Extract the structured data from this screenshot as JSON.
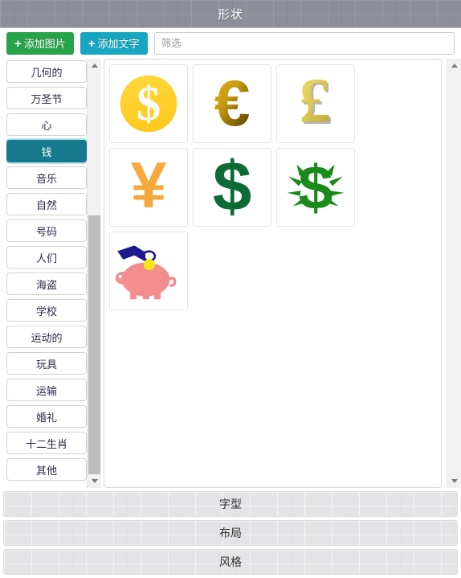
{
  "window": {
    "title": "形状"
  },
  "toolbar": {
    "add_image_label": "添加图片",
    "add_text_label": "添加文字",
    "filter_placeholder": "筛选",
    "filter_value": ""
  },
  "sidebar": {
    "selected": "钱",
    "items": [
      {
        "label": "几何的",
        "selected": false
      },
      {
        "label": "万圣节",
        "selected": false
      },
      {
        "label": "心",
        "selected": false
      },
      {
        "label": "钱",
        "selected": true
      },
      {
        "label": "音乐",
        "selected": false
      },
      {
        "label": "自然",
        "selected": false
      },
      {
        "label": "号码",
        "selected": false
      },
      {
        "label": "人们",
        "selected": false
      },
      {
        "label": "海盗",
        "selected": false
      },
      {
        "label": "学校",
        "selected": false
      },
      {
        "label": "运动的",
        "selected": false
      },
      {
        "label": "玩具",
        "selected": false
      },
      {
        "label": "运输",
        "selected": false
      },
      {
        "label": "婚礼",
        "selected": false
      },
      {
        "label": "十二生肖",
        "selected": false
      },
      {
        "label": "其他",
        "selected": false
      }
    ]
  },
  "shapes": [
    {
      "name": "gold-dollar-coin-shape",
      "glyph": "$"
    },
    {
      "name": "gold-euro-shape",
      "glyph": "€"
    },
    {
      "name": "gold-pound-shape",
      "glyph": "£"
    },
    {
      "name": "orange-yen-shape",
      "glyph": "¥"
    },
    {
      "name": "green-dollar-shape",
      "glyph": "$"
    },
    {
      "name": "green-shining-dollar-shape",
      "glyph": "$"
    },
    {
      "name": "piggy-bank-shape",
      "glyph": "piggy-bank"
    }
  ],
  "accordion": [
    {
      "label": "字型"
    },
    {
      "label": "布局"
    },
    {
      "label": "风格"
    }
  ],
  "colors": {
    "header_bg": "#8e8e9b",
    "add_image_green": "#27a349",
    "add_text_teal": "#18a5bf",
    "selected_teal": "#16798e",
    "gold": "#ffc91e",
    "orange_yen": "#f7a83c",
    "dark_green": "#0a6b35",
    "bright_green": "#1a8a1a",
    "pig_pink": "#f48d8d",
    "hand_navy": "#1a1a8c",
    "coin_yellow": "#f5e617"
  }
}
